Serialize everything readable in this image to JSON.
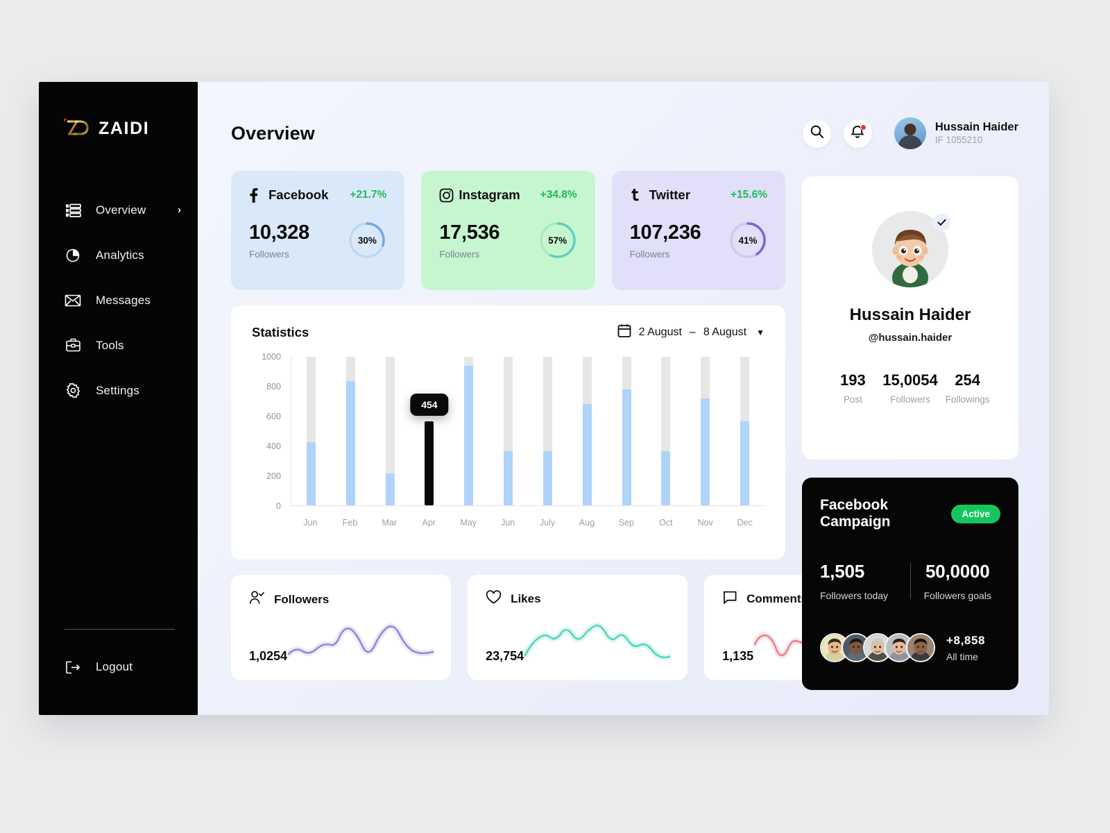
{
  "brand": {
    "logo_text": "ZAIDI",
    "logo_mark": "zd-monogram"
  },
  "sidebar": {
    "items": [
      {
        "label": "Overview",
        "icon": "list-dashboard-icon",
        "active": true,
        "chevron": "›"
      },
      {
        "label": "Analytics",
        "icon": "pie-chart-icon",
        "active": false
      },
      {
        "label": "Messages",
        "icon": "envelope-icon",
        "active": false
      },
      {
        "label": "Tools",
        "icon": "toolbox-icon",
        "active": false
      },
      {
        "label": "Settings",
        "icon": "gear-icon",
        "active": false
      }
    ],
    "logout": {
      "label": "Logout",
      "icon": "logout-icon"
    }
  },
  "header": {
    "title": "Overview",
    "search_icon": "search-icon",
    "bell_icon": "bell-icon",
    "user": {
      "name": "Hussain Haider",
      "id": "IF 1055210"
    }
  },
  "social_cards": [
    {
      "network": "Facebook",
      "icon": "facebook-icon",
      "delta": "+21.7%",
      "value": "10,328",
      "sublabel": "Followers",
      "percent": "30%",
      "percent_value": 30,
      "bg": "#d9e9f9",
      "ring": "#6ea8e8",
      "track": "#bcd8f3"
    },
    {
      "network": "Instagram",
      "icon": "instagram-icon",
      "delta": "+34.8%",
      "value": "17,536",
      "sublabel": "Followers",
      "percent": "57%",
      "percent_value": 57,
      "bg": "#c6f6cf",
      "ring": "#5ecfc0",
      "track": "#a9ebc0"
    },
    {
      "network": "Twitter",
      "icon": "twitter-icon",
      "delta": "+15.6%",
      "value": "107,236",
      "sublabel": "Followers",
      "percent": "41%",
      "percent_value": 41,
      "bg": "#e2dff8",
      "ring": "#7c5fd8",
      "track": "#cfc9ef"
    }
  ],
  "statistics": {
    "title": "Statistics",
    "calendar_icon": "calendar-icon",
    "date_start": "2 August",
    "date_sep": "–",
    "date_end": "8 August",
    "chevron": "▼"
  },
  "chart_data": {
    "type": "bar",
    "title": "Statistics",
    "categories": [
      "Jun",
      "Feb",
      "Mar",
      "Apr",
      "May",
      "Jun",
      "July",
      "Aug",
      "Sep",
      "Oct",
      "Nov",
      "Dec"
    ],
    "values": [
      425,
      835,
      215,
      454,
      940,
      365,
      365,
      680,
      780,
      365,
      720,
      565
    ],
    "highlight_index": 3,
    "highlight_label": "454",
    "track_max": 1000,
    "ylim": [
      0,
      1000
    ],
    "yticks": [
      1000,
      800,
      600,
      400,
      200,
      0
    ],
    "xlabel": "",
    "ylabel": "",
    "grid": false,
    "bar_color": "#aed4fa",
    "track_color": "#e6e6e6",
    "highlight_color": "#0a0a0a"
  },
  "metrics": [
    {
      "title": "Followers",
      "icon": "user-check-icon",
      "value": "1,0254",
      "color": "#9a86d8",
      "spark": "followers-sparkline"
    },
    {
      "title": "Likes",
      "icon": "heart-icon",
      "value": "23,754",
      "color": "#55d6bd",
      "spark": "likes-sparkline"
    },
    {
      "title": "Comments",
      "icon": "comment-icon",
      "value": "1,135",
      "color": "#e8808f",
      "spark": "comments-sparkline"
    }
  ],
  "profile": {
    "avatar": "cartoon-boy-avatar",
    "verified_icon": "verified-check-icon",
    "name": "Hussain Haider",
    "handle": "@hussain.haider",
    "stats": [
      {
        "value": "193",
        "label": "Post"
      },
      {
        "value": "15,0054",
        "label": "Followers"
      },
      {
        "value": "254",
        "label": "Followings"
      }
    ]
  },
  "campaign": {
    "title": "Facebook Campaign",
    "status": "Active",
    "status_color": "#17c55f",
    "today_value": "1,505",
    "today_label": "Followers today",
    "goal_value": "50,0000",
    "goal_label": "Followers goals",
    "plus_value": "+8,858",
    "plus_label": "All time",
    "avatar_count": 5
  }
}
